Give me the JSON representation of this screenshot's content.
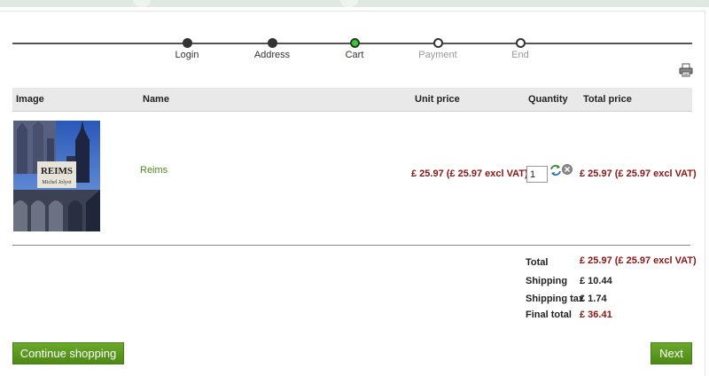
{
  "steps": [
    {
      "label": "Login",
      "state": "done"
    },
    {
      "label": "Address",
      "state": "done"
    },
    {
      "label": "Cart",
      "state": "current"
    },
    {
      "label": "Payment",
      "state": "todo"
    },
    {
      "label": "End",
      "state": "todo"
    }
  ],
  "table": {
    "headers": {
      "image": "Image",
      "name": "Name",
      "unit_price": "Unit price",
      "quantity": "Quantity",
      "total_price": "Total price"
    }
  },
  "item": {
    "cover_title": "REIMS",
    "cover_author": "Michel Jolyot",
    "name": "Reims",
    "unit_price": "£ 25.97 (£ 25.97 excl VAT)",
    "quantity": "1",
    "total_price": "£ 25.97 (£ 25.97 excl VAT)"
  },
  "summary": {
    "total_label": "Total",
    "total_value": "£ 25.97 (£ 25.97 excl VAT)",
    "shipping_label": "Shipping",
    "shipping_value": "£ 10.44",
    "shipping_tax_label": "Shipping tax",
    "shipping_tax_value": "£ 1.74",
    "final_total_label": "Final total",
    "final_total_value": "£ 36.41"
  },
  "buttons": {
    "continue": "Continue shopping",
    "next": "Next"
  },
  "icons": {
    "print": "printer-icon",
    "refresh": "refresh-icon",
    "remove": "remove-icon"
  },
  "colors": {
    "accent_green": "#5b9a1f",
    "price_red": "#8b1414",
    "current_step": "#2bd12b"
  }
}
